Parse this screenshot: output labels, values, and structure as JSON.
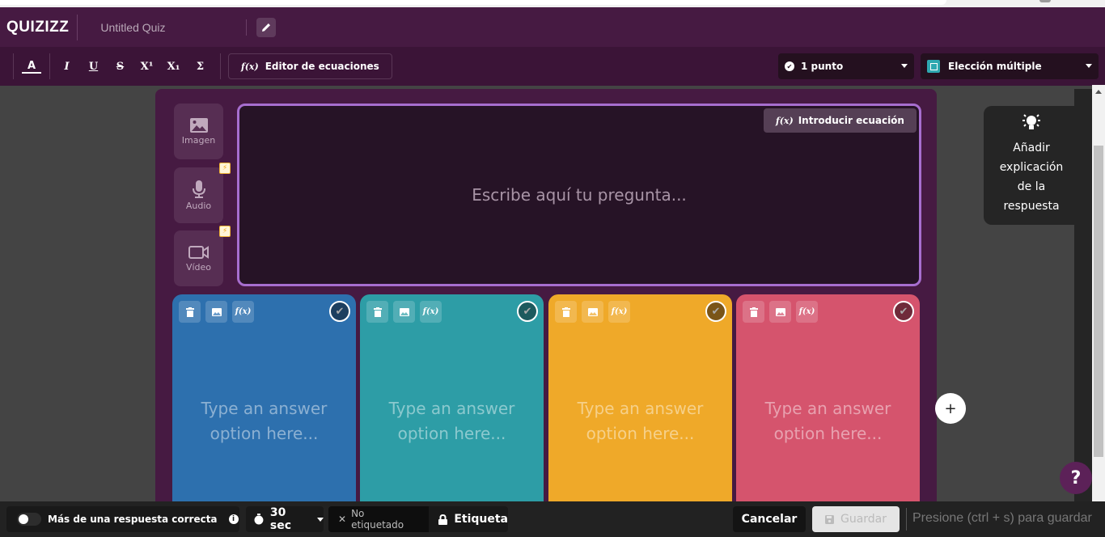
{
  "app": {
    "logo": "QUIZIZZ",
    "quiz_title": "Untitled Quiz"
  },
  "toolbar": {
    "format_buttons": [
      {
        "name": "text-color",
        "glyph": "A"
      },
      {
        "name": "italic",
        "glyph": "I"
      },
      {
        "name": "underline",
        "glyph": "U"
      },
      {
        "name": "strikethrough",
        "glyph": "S"
      },
      {
        "name": "superscript",
        "glyph": "X¹"
      },
      {
        "name": "subscript",
        "glyph": "X₁"
      },
      {
        "name": "sigma",
        "glyph": "Σ"
      }
    ],
    "fx_glyph": "f(x)",
    "equation_editor_label": "Editor de ecuaciones",
    "points_label": "1 punto",
    "question_type_label": "Elección múltiple"
  },
  "media": {
    "image_label": "Imagen",
    "audio_label": "Audio",
    "video_label": "Vídeo",
    "premium_badge": "⚡"
  },
  "question": {
    "placeholder": "Escribe aquí tu pregunta...",
    "insert_equation_label": "Introducir ecuación"
  },
  "answers": [
    {
      "color": "#2d70ae",
      "check_fill": "#1d3f5f",
      "placeholder_line1": "Type an answer",
      "placeholder_line2": "option here..."
    },
    {
      "color": "#2d9da6",
      "check_fill": "#1d5a5e",
      "placeholder_line1": "Type an answer",
      "placeholder_line2": "option here..."
    },
    {
      "color": "#efa929",
      "check_fill": "#7a5518",
      "placeholder_line1": "Type an answer",
      "placeholder_line2": "option here..."
    },
    {
      "color": "#d5546d",
      "check_fill": "#6f2a3a",
      "placeholder_line1": "Type an answer",
      "placeholder_line2": "option here..."
    }
  ],
  "add_option_glyph": "+",
  "explanation": {
    "line1": "Añadir",
    "line2": "explicación",
    "line3": "de la",
    "line4": "respuesta"
  },
  "help_glyph": "?",
  "bottombar": {
    "multiple_correct_label": "Más de una respuesta correcta",
    "timer_label": "30 sec",
    "no_tag_label": "No etiquetado",
    "tag_label": "Etiqueta",
    "cancel_label": "Cancelar",
    "save_label": "Guardar",
    "save_hint": "Presione (ctrl + s) para guardar"
  }
}
